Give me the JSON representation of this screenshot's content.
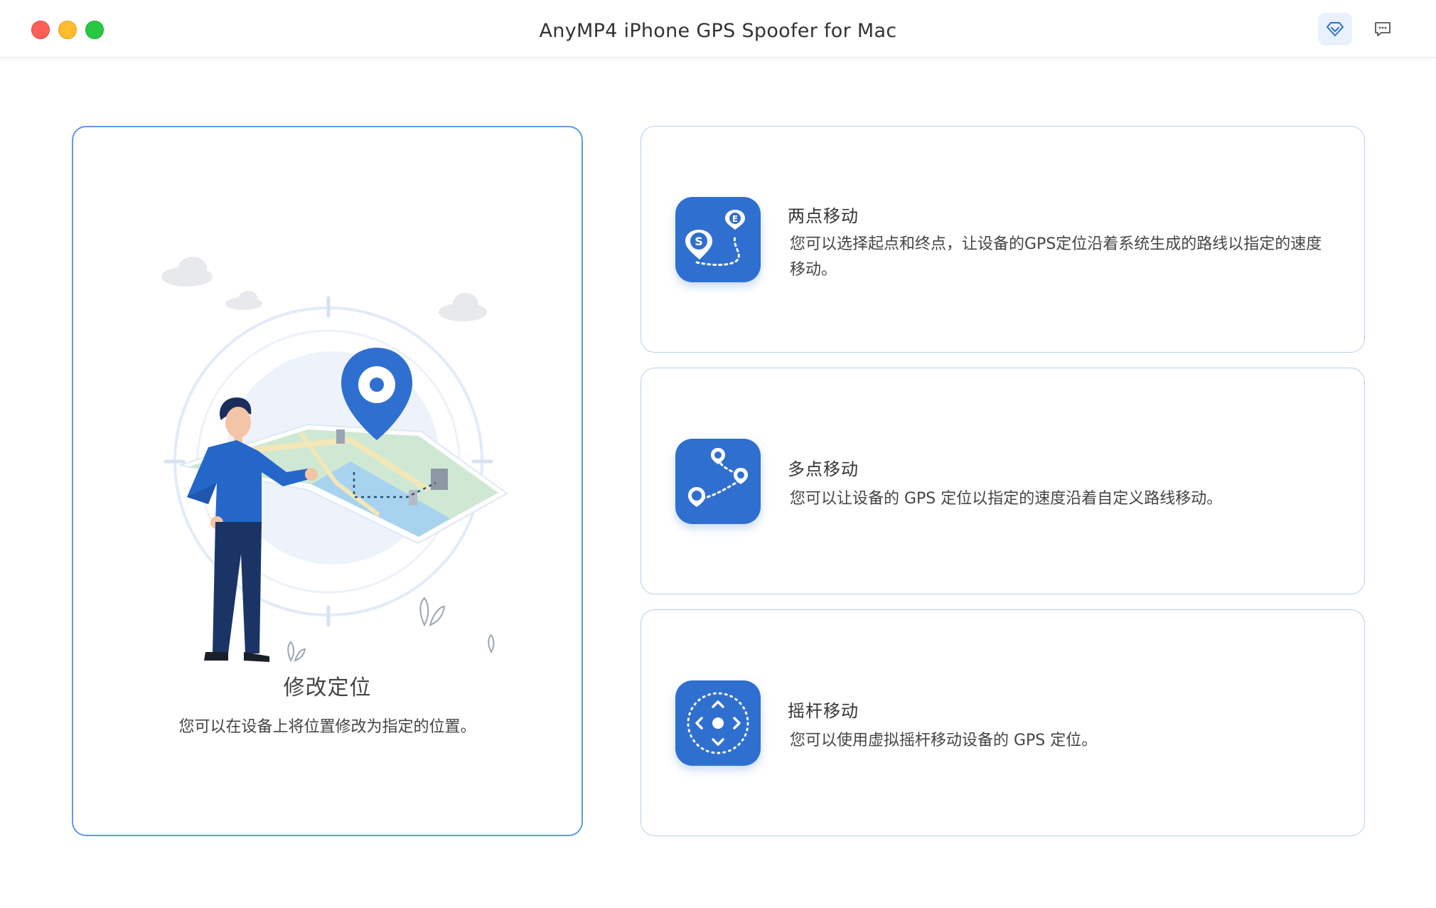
{
  "window": {
    "title": "AnyMP4 iPhone GPS Spoofer for Mac",
    "toolbar_icons": [
      "premium-diamond-icon",
      "feedback-message-icon"
    ]
  },
  "main_card": {
    "title": "修改定位",
    "description": "您可以在设备上将位置修改为指定的位置。",
    "illustration": "person-with-map-pin-illustration"
  },
  "modes": [
    {
      "title": "两点移动",
      "description": "您可以选择起点和终点，让设备的GPS定位沿着系统生成的路线以指定的速度移动。",
      "icon": "two-point-route-icon"
    },
    {
      "title": "多点移动",
      "description": "您可以让设备的 GPS 定位以指定的速度沿着自定义路线移动。",
      "icon": "multi-point-route-icon"
    },
    {
      "title": "摇杆移动",
      "description": "您可以使用虚拟摇杆移动设备的 GPS 定位。",
      "icon": "joystick-icon"
    }
  ],
  "colors": {
    "accent": "#2f6fcf",
    "selected_border": "#5e9ae5",
    "card_border": "#b9cfe8"
  }
}
